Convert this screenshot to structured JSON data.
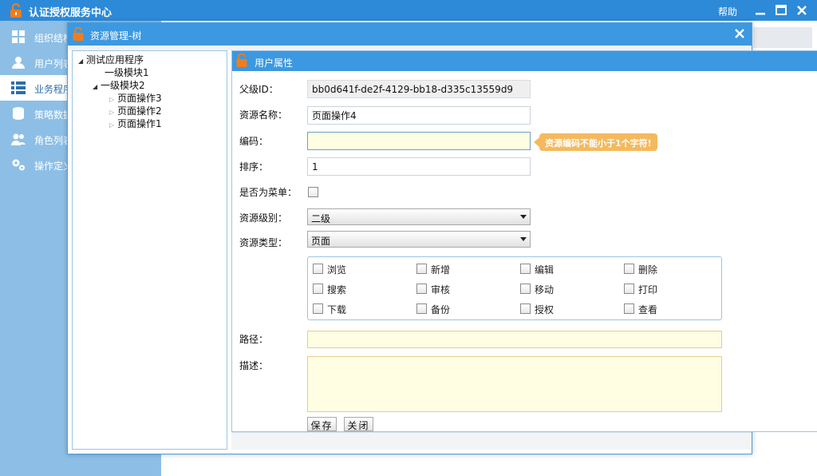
{
  "app": {
    "title": "认证授权服务中心",
    "help": "帮助"
  },
  "sidebar": {
    "items": [
      {
        "label": "组织结构",
        "icon": "grid-icon"
      },
      {
        "label": "用户列表",
        "icon": "user-icon"
      },
      {
        "label": "业务程序",
        "icon": "list-icon"
      },
      {
        "label": "策略数据",
        "icon": "database-icon"
      },
      {
        "label": "角色列表",
        "icon": "users-icon"
      },
      {
        "label": "操作定义",
        "icon": "gears-icon"
      }
    ],
    "active_index": 2
  },
  "dialog": {
    "title": "资源管理-树"
  },
  "tree": {
    "nodes": [
      {
        "label": "测试应用程序",
        "expanded": true
      },
      {
        "label": "一级模块1"
      },
      {
        "label": "一级模块2",
        "expanded": true
      },
      {
        "label": "页面操作3",
        "expanded": false
      },
      {
        "label": "页面操作2",
        "expanded": false
      },
      {
        "label": "页面操作1",
        "expanded": false
      }
    ]
  },
  "props": {
    "title": "用户属性",
    "parent_id_label": "父级ID：",
    "parent_id_value": "bb0d641f-de2f-4129-bb18-d335c13559d9",
    "name_label": "资源名称：",
    "name_value": "页面操作4",
    "code_label": "编码：",
    "code_value": "",
    "code_error": "资源编码不能小于1个字符!",
    "order_label": "排序：",
    "order_value": "1",
    "is_menu_label": "是否为菜单：",
    "is_menu_checked": false,
    "level_label": "资源级别：",
    "level_value": "二级",
    "type_label": "资源类型：",
    "type_value": "页面",
    "operations": [
      {
        "label": "浏览",
        "checked": false
      },
      {
        "label": "新增",
        "checked": false
      },
      {
        "label": "编辑",
        "checked": false
      },
      {
        "label": "删除",
        "checked": false
      },
      {
        "label": "搜索",
        "checked": false
      },
      {
        "label": "审核",
        "checked": false
      },
      {
        "label": "移动",
        "checked": false
      },
      {
        "label": "打印",
        "checked": false
      },
      {
        "label": "下载",
        "checked": false
      },
      {
        "label": "备份",
        "checked": false
      },
      {
        "label": "授权",
        "checked": false
      },
      {
        "label": "查看",
        "checked": false
      }
    ],
    "path_label": "路径：",
    "path_value": "",
    "desc_label": "描述：",
    "desc_value": "",
    "save_label": "保存",
    "close_label": "关闭"
  },
  "colors": {
    "topbar": "#2c8ad8",
    "header": "#3c98e0",
    "sidebar": "#8dbfe6",
    "tooltip": "#f5b95d",
    "input_highlight": "#fffde2",
    "logo": "#f07d1c"
  }
}
